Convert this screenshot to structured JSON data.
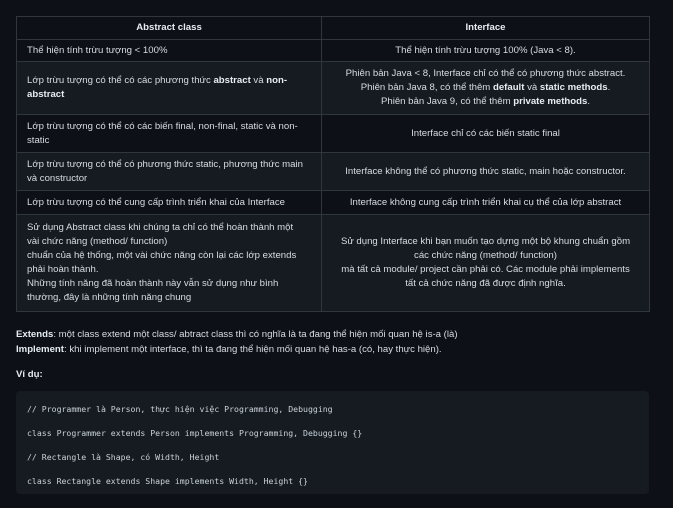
{
  "table": {
    "headers": [
      "Abstract class",
      "Interface"
    ],
    "rows": [
      {
        "abstract": [
          "Thể hiện tính trừu tượng < 100%"
        ],
        "interface": [
          "Thể hiện tính trừu tượng 100% (Java < 8)."
        ]
      },
      {
        "abstract": [
          "Lớp trừu tượng có thể có các phương thức abstract và non-",
          "abstract"
        ],
        "interface": [
          "Phiên bản Java < 8, Interface chỉ có thể có phương thức abstract.",
          "Phiên bản Java 8, có thể thêm default và static methods.",
          "Phiên bản Java 9, có thể thêm private methods."
        ]
      },
      {
        "abstract": [
          "Lớp trừu tượng có thể có các biến final, non-final, static và non-",
          "static"
        ],
        "interface": [
          "Interface chỉ có các biến static final"
        ]
      },
      {
        "abstract": [
          "Lớp trừu tượng có thể có phương thức static, phương thức main",
          "và constructor"
        ],
        "interface": [
          "Interface không thể có phương thức static, main hoặc constructor."
        ]
      },
      {
        "abstract": [
          "Lớp trừu tượng có thể cung cấp trình triển khai của Interface"
        ],
        "interface": [
          "Interface không cung cấp trình triển khai cụ thể của lớp abstract"
        ]
      },
      {
        "abstract": [
          "Sử dụng Abstract class khi chúng ta chỉ có thể hoàn thành một",
          "vài chức năng (method/ function)",
          "chuẩn của hệ thống, một vài chức năng còn lại các lớp extends",
          "phải hoàn thành.",
          "Những tính năng đã hoàn thành này vẫn sử dụng như bình",
          "thường, đây là những tính năng chung"
        ],
        "interface": [
          "Sử dụng Interface khi bạn muốn tạo dựng một bộ khung chuẩn gồm",
          "các chức năng (method/ function)",
          "mà tất cả module/ project cần phải có. Các module phải implements",
          "tất cả chức năng đã được định nghĩa."
        ]
      }
    ]
  },
  "notes": {
    "extends_term": "Extends",
    "extends_text": ": một class extend một class/ abtract class thì có nghĩa là ta đang thể hiện mối quan hệ is-a (là)",
    "implement_term": "Implement",
    "implement_text": ": khi implement một interface, thì ta đang thể hiện mối quan hệ has-a (có, hay thực hiện)."
  },
  "example_heading": "Ví dụ:",
  "code_lines": [
    "// Programmer là Person, thực hiện việc Programming, Debugging",
    "class Programmer extends Person implements Programming, Debugging {}",
    "// Rectangle là Shape, có Width, Height",
    "class Rectangle extends Shape implements Width, Height {}"
  ]
}
